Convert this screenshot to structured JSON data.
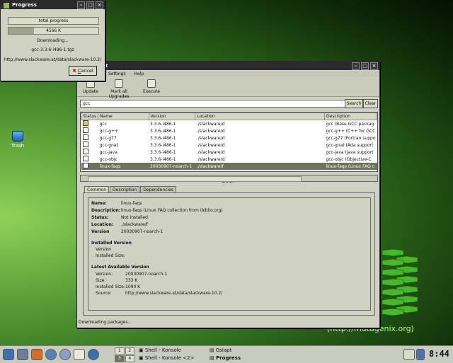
{
  "desktop": {
    "trash_label": "Trash",
    "brand_url": "(http://mutagenix.org)"
  },
  "progress_dialog": {
    "title": "Progress",
    "total_label": "total progress",
    "total_fraction": 0.0,
    "file_size_label": "4566 K",
    "file_fraction": 0.28,
    "status_text": "Downloading...",
    "filename": "gcc-3.3.6-i486-1.tgz",
    "source_url": "http://www.slackware.at/data/slackware-10.2/",
    "cancel_label": "Cancel",
    "cancel_mnemonic": "C"
  },
  "gslapt": {
    "title": "t",
    "menu": [
      "",
      "Settings",
      "Help"
    ],
    "toolbar": {
      "update_label": "Update",
      "mark_all_label": "Mark all Upgrades",
      "execute_label": "Execute"
    },
    "search": {
      "value": "gcc",
      "search_label": "Search",
      "clear_label": "Clear"
    },
    "columns": [
      "Status",
      "Name",
      "Version",
      "Location",
      "Description"
    ],
    "rows": [
      {
        "status": "marked",
        "name": "gcc",
        "version": "3.3.6-i486-1",
        "location": "./slackware/d",
        "description": "gcc (Base GCC packag"
      },
      {
        "status": "",
        "name": "gcc-g++",
        "version": "3.3.6-i486-1",
        "location": "./slackware/d",
        "description": "gcc-g++ (C++ for GCC"
      },
      {
        "status": "",
        "name": "gcc-g77",
        "version": "3.3.6-i486-1",
        "location": "./slackware/d",
        "description": "gcc-g77 (Fortran suppo"
      },
      {
        "status": "",
        "name": "gcc-gnat",
        "version": "3.3.6-i486-1",
        "location": "./slackware/d",
        "description": "gcc-gnat (Ada support"
      },
      {
        "status": "",
        "name": "gcc-java",
        "version": "3.3.6-i486-1",
        "location": "./slackware/d",
        "description": "gcc-java (Java support"
      },
      {
        "status": "",
        "name": "gcc-objc",
        "version": "3.3.6-i486-1",
        "location": "./slackware/d",
        "description": "gcc-objc (Objective-C"
      },
      {
        "status": "",
        "name": "linux-faqs",
        "version": "20030907-noarch-1",
        "location": "./slackware/f",
        "description": "linux-faqs (Linux FAQ c"
      }
    ],
    "tabs": [
      "Common",
      "Description",
      "Dependencies"
    ],
    "details": {
      "name_label": "Name:",
      "name": "linux-faqs",
      "desc_label": "Description:",
      "desc": "linux-faqs (Linux FAQ collection from ibiblio.org)",
      "status_label": "Status:",
      "status": "Not Installed",
      "location_label": "Location:",
      "location": "./slackware/f",
      "version_label": "Version",
      "version": "20030907-noarch-1",
      "installed_heading": "Installed Version",
      "inst_version_label": "Version",
      "inst_size_label": "Installed Size:",
      "latest_heading": "Latest Available Version",
      "latest_version_label": "Version:",
      "latest_version": "20030907-noarch-1",
      "size_label": "Size:",
      "size": "333 K",
      "latest_installed_size_label": "Installed Size:",
      "latest_installed_size": "1090 K",
      "source_label": "Source:",
      "source": "http://www.slackware.at/data/slackware-10.2/"
    },
    "statusbar": "Downloading packages..."
  },
  "taskbar": {
    "pager": [
      "1",
      "2",
      "3",
      "4"
    ],
    "tasks": [
      {
        "label": "Shell - Konsole"
      },
      {
        "label": "Gslapt"
      },
      {
        "label": "Shell - Konsole <2>"
      },
      {
        "label": "Progress"
      }
    ],
    "clock": "8:44"
  }
}
